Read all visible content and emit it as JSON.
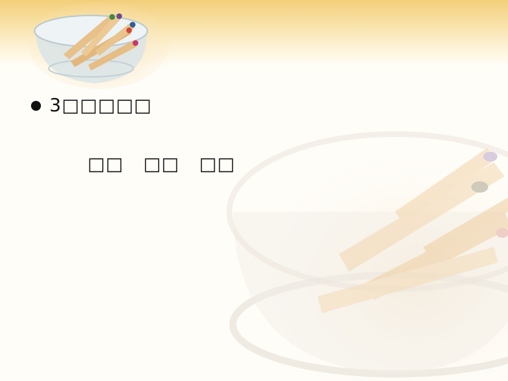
{
  "slide": {
    "bullet_text": "3□□□□□",
    "sub_items": [
      "□□",
      "□□",
      "□□"
    ]
  },
  "colors": {
    "top_band": "#f3cf7a",
    "background": "#fffdf8",
    "text": "#111111"
  },
  "images": {
    "logo_art": "pencils-in-glass-bowl",
    "background_art": "faded-pencils-in-glass-bowl"
  }
}
